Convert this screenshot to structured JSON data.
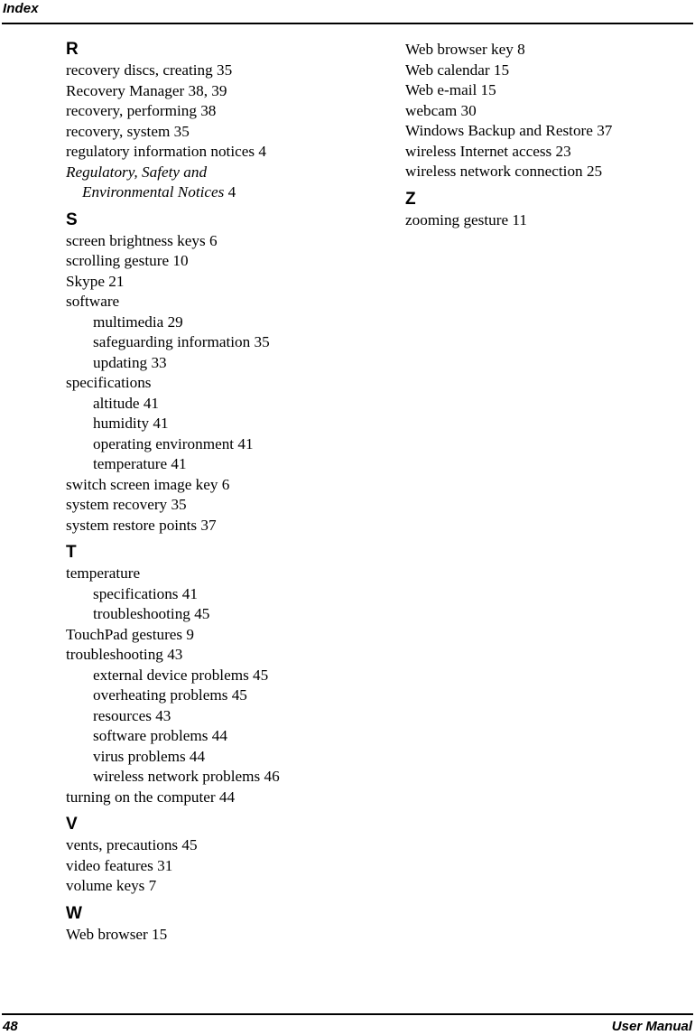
{
  "header": {
    "title": "Index"
  },
  "footer": {
    "page_number": "48",
    "document_label": "User Manual"
  },
  "columns": [
    {
      "sections": [
        {
          "letter": "R",
          "entries": [
            {
              "text": "recovery discs, creating 35",
              "level": 0,
              "style": "roman"
            },
            {
              "text": "Recovery Manager 38, 39",
              "level": 0,
              "style": "roman"
            },
            {
              "text": "recovery, performing 38",
              "level": 0,
              "style": "roman"
            },
            {
              "text": "recovery, system 35",
              "level": 0,
              "style": "roman"
            },
            {
              "text": "regulatory information notices 4",
              "level": 0,
              "style": "roman"
            },
            {
              "text": "Regulatory, Safety and",
              "continuation": "Environmental Notices",
              "trailing": " 4",
              "level": 0,
              "style": "italic"
            }
          ]
        },
        {
          "letter": "S",
          "entries": [
            {
              "text": "screen brightness keys 6",
              "level": 0,
              "style": "roman"
            },
            {
              "text": "scrolling gesture 10",
              "level": 0,
              "style": "roman"
            },
            {
              "text": "Skype 21",
              "level": 0,
              "style": "roman"
            },
            {
              "text": "software",
              "level": 0,
              "style": "roman"
            },
            {
              "text": "multimedia 29",
              "level": 1,
              "style": "roman"
            },
            {
              "text": "safeguarding information 35",
              "level": 1,
              "style": "roman"
            },
            {
              "text": "updating 33",
              "level": 1,
              "style": "roman"
            },
            {
              "text": "specifications",
              "level": 0,
              "style": "roman"
            },
            {
              "text": "altitude 41",
              "level": 1,
              "style": "roman"
            },
            {
              "text": "humidity 41",
              "level": 1,
              "style": "roman"
            },
            {
              "text": "operating environment 41",
              "level": 1,
              "style": "roman"
            },
            {
              "text": "temperature 41",
              "level": 1,
              "style": "roman"
            },
            {
              "text": "switch screen image key 6",
              "level": 0,
              "style": "roman"
            },
            {
              "text": "system recovery 35",
              "level": 0,
              "style": "roman"
            },
            {
              "text": "system restore points 37",
              "level": 0,
              "style": "roman"
            }
          ]
        },
        {
          "letter": "T",
          "entries": [
            {
              "text": "temperature",
              "level": 0,
              "style": "roman"
            },
            {
              "text": "specifications 41",
              "level": 1,
              "style": "roman"
            },
            {
              "text": "troubleshooting 45",
              "level": 1,
              "style": "roman"
            },
            {
              "text": "TouchPad gestures 9",
              "level": 0,
              "style": "roman"
            },
            {
              "text": "troubleshooting 43",
              "level": 0,
              "style": "roman"
            },
            {
              "text": "external device problems 45",
              "level": 1,
              "style": "roman"
            },
            {
              "text": "overheating problems 45",
              "level": 1,
              "style": "roman"
            },
            {
              "text": "resources 43",
              "level": 1,
              "style": "roman"
            },
            {
              "text": "software problems 44",
              "level": 1,
              "style": "roman"
            },
            {
              "text": "virus problems 44",
              "level": 1,
              "style": "roman"
            },
            {
              "text": "wireless network problems 46",
              "level": 1,
              "style": "roman"
            },
            {
              "text": "turning on the computer 44",
              "level": 0,
              "style": "roman"
            }
          ]
        },
        {
          "letter": "V",
          "entries": [
            {
              "text": "vents, precautions 45",
              "level": 0,
              "style": "roman"
            },
            {
              "text": "video features 31",
              "level": 0,
              "style": "roman"
            },
            {
              "text": "volume keys 7",
              "level": 0,
              "style": "roman"
            }
          ]
        },
        {
          "letter": "W",
          "entries": [
            {
              "text": "Web browser 15",
              "level": 0,
              "style": "roman"
            }
          ]
        }
      ]
    },
    {
      "sections": [
        {
          "letter": "",
          "entries": [
            {
              "text": "Web browser key 8",
              "level": 0,
              "style": "roman"
            },
            {
              "text": "Web calendar 15",
              "level": 0,
              "style": "roman"
            },
            {
              "text": "Web e-mail 15",
              "level": 0,
              "style": "roman"
            },
            {
              "text": "webcam 30",
              "level": 0,
              "style": "roman"
            },
            {
              "text": "Windows Backup and Restore 37",
              "level": 0,
              "style": "roman"
            },
            {
              "text": "wireless Internet access 23",
              "level": 0,
              "style": "roman"
            },
            {
              "text": "wireless network connection 25",
              "level": 0,
              "style": "roman"
            }
          ]
        },
        {
          "letter": "Z",
          "entries": [
            {
              "text": "zooming gesture 11",
              "level": 0,
              "style": "roman"
            }
          ]
        }
      ]
    }
  ]
}
